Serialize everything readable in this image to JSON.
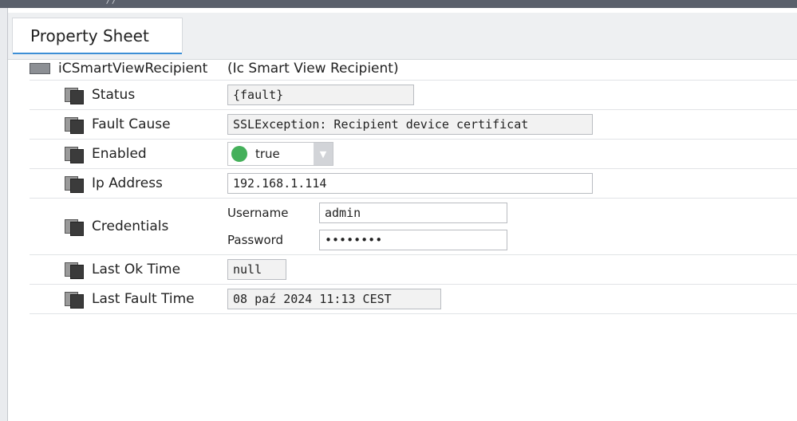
{
  "header": {
    "crumb": "/ /"
  },
  "tabs": [
    {
      "label": "Property Sheet"
    }
  ],
  "component": {
    "name": "iCSmartViewRecipient",
    "type": "(Ic Smart View Recipient)"
  },
  "properties": {
    "status": {
      "label": "Status",
      "value": "{fault}"
    },
    "fault_cause": {
      "label": "Fault Cause",
      "value": "SSLException: Recipient device certificat"
    },
    "enabled": {
      "label": "Enabled",
      "value": "true",
      "indicator_color": "#44b05a"
    },
    "ip_address": {
      "label": "Ip Address",
      "value": "192.168.1.114"
    },
    "credentials": {
      "label": "Credentials",
      "username_label": "Username",
      "username": "admin",
      "password_label": "Password",
      "password": "••••••••"
    },
    "last_ok_time": {
      "label": "Last Ok Time",
      "value": "null"
    },
    "last_fault_time": {
      "label": "Last Fault Time",
      "value": "08 paź 2024 11:13 CEST"
    }
  },
  "colors": {
    "tab_underline": "#3d8fd6",
    "topbar": "#5a606b"
  }
}
